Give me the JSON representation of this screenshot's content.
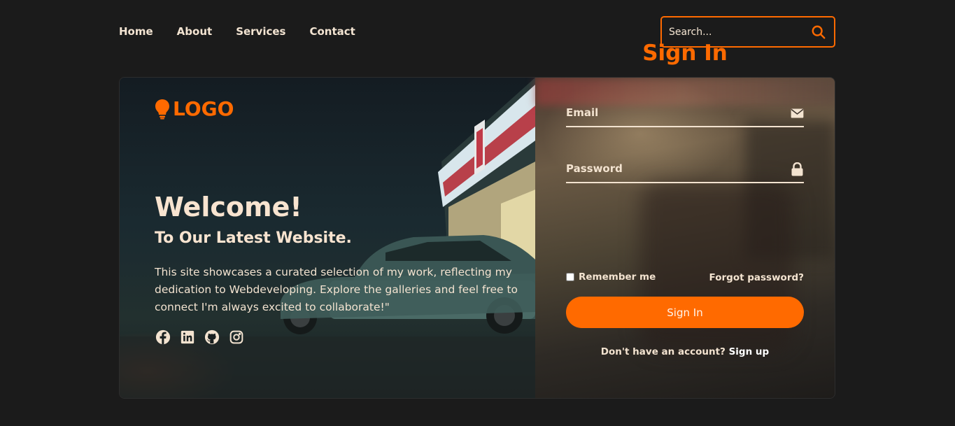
{
  "nav": {
    "items": [
      {
        "label": "Home"
      },
      {
        "label": "About"
      },
      {
        "label": "Services"
      },
      {
        "label": "Contact"
      }
    ]
  },
  "search": {
    "placeholder": "Search...",
    "icon": "search-icon"
  },
  "hero": {
    "logo_text": "LOGO",
    "logo_icon": "lightbulb-icon",
    "title": "Welcome!",
    "subtitle": "To Our Latest Website.",
    "description": "This site showcases a curated selection of my work, reflecting my dedication to Webdeveloping. Explore the galleries and feel free to connect I'm always excited to collaborate!\"",
    "social": [
      "facebook-icon",
      "linkedin-icon",
      "github-icon",
      "instagram-icon"
    ]
  },
  "login": {
    "title": "Sign In",
    "email_placeholder": "Email",
    "password_placeholder": "Password",
    "remember_label": "Remember me",
    "forgot_label": "Forgot password?",
    "submit_label": "Sign In",
    "signup_prompt": "Don't have an account?",
    "signup_link": "Sign up"
  },
  "colors": {
    "accent": "#ff6a00",
    "background": "#1b1b1b",
    "text": "#f5e6d3"
  }
}
